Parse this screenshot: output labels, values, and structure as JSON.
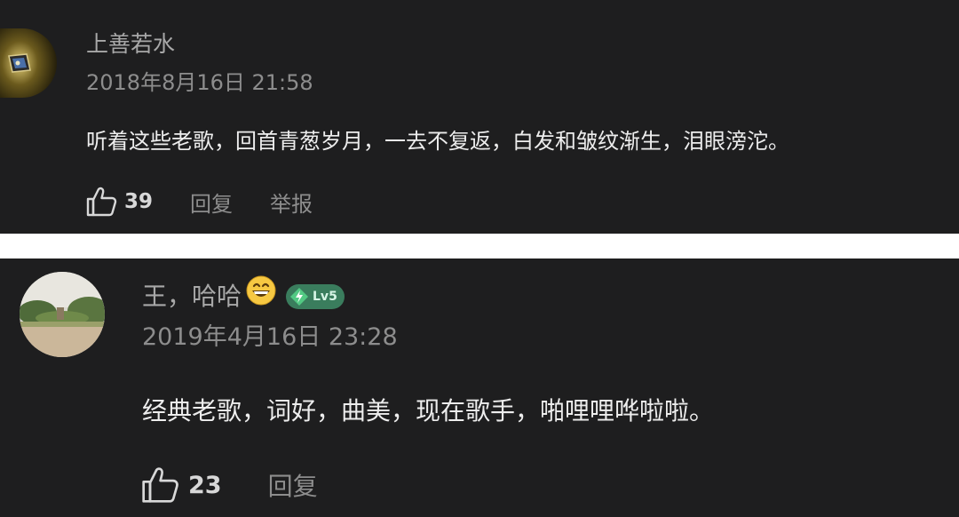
{
  "comments": [
    {
      "username": "上善若水",
      "timestamp": "2018年8月16日 21:58",
      "content": "听着这些老歌，回首青葱岁月，一去不复返，白发和皱纹渐生，泪眼滂沱。",
      "likes": "39",
      "reply_label": "回复",
      "report_label": "举报",
      "avatar_icon": "framed-picture-avatar"
    },
    {
      "username": "王，哈哈",
      "emoji": "grinning-face-icon",
      "level_badge": "Lv5",
      "timestamp": "2019年4月16日 23:28",
      "content": "经典老歌，词好，曲美，现在歌手，啪哩哩哗啦啦。",
      "likes": "23",
      "reply_label": "回复",
      "avatar_icon": "park-photo-avatar"
    }
  ],
  "colors": {
    "card_background": "#1e1e1f",
    "separator": "#ffffff",
    "username": "#a8a8a8",
    "timestamp": "#8d8d8d",
    "content": "#ededed",
    "badge": "#3a7d5d"
  }
}
